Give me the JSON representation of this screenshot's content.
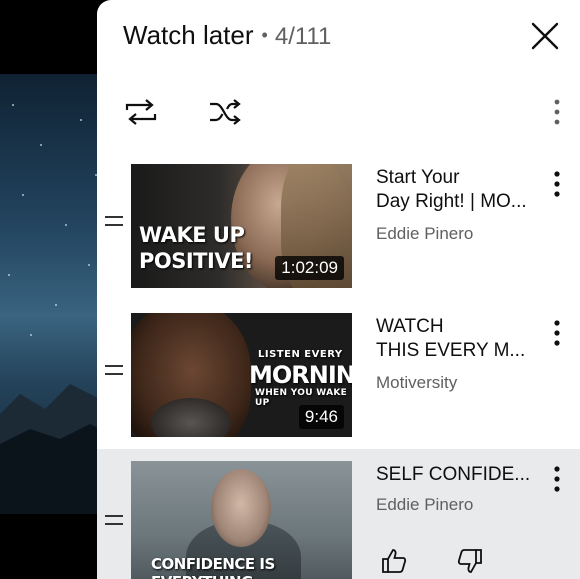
{
  "playlist": {
    "title": "Watch later",
    "separator": "•",
    "position": "4/111"
  },
  "icons": {
    "close": "close-icon",
    "loop": "loop-icon",
    "shuffle": "shuffle-icon",
    "menu": "more-vert-icon",
    "drag": "drag-handle-icon",
    "like": "thumbs-up-icon",
    "dislike": "thumbs-down-icon"
  },
  "colors": {
    "panel_bg": "#ffffff",
    "active_row_bg": "#e8eaeb",
    "text_primary": "#0f0f0f",
    "text_secondary": "#606060"
  },
  "videos": [
    {
      "title": "Start Your Day Right! | MO...",
      "title_line1": "Start Your",
      "title_line2": "Day Right! | MO...",
      "channel": "Eddie Pinero",
      "duration": "1:02:09",
      "thumbnail_text": [
        "WAKE UP",
        "POSITIVE!"
      ]
    },
    {
      "title": "WATCH THIS EVERY M...",
      "title_line1": "WATCH",
      "title_line2": "THIS EVERY M...",
      "channel": "Motiversity",
      "duration": "9:46",
      "thumbnail_text": [
        "LISTEN EVERY",
        "MORNING",
        "WHEN YOU WAKE UP"
      ]
    },
    {
      "title": "SELF CONFIDE...",
      "title_line1": "SELF CONFIDE...",
      "channel": "Eddie Pinero",
      "active": true,
      "thumbnail_text": [
        "CONFIDENCE IS EVERYTHING"
      ]
    }
  ]
}
